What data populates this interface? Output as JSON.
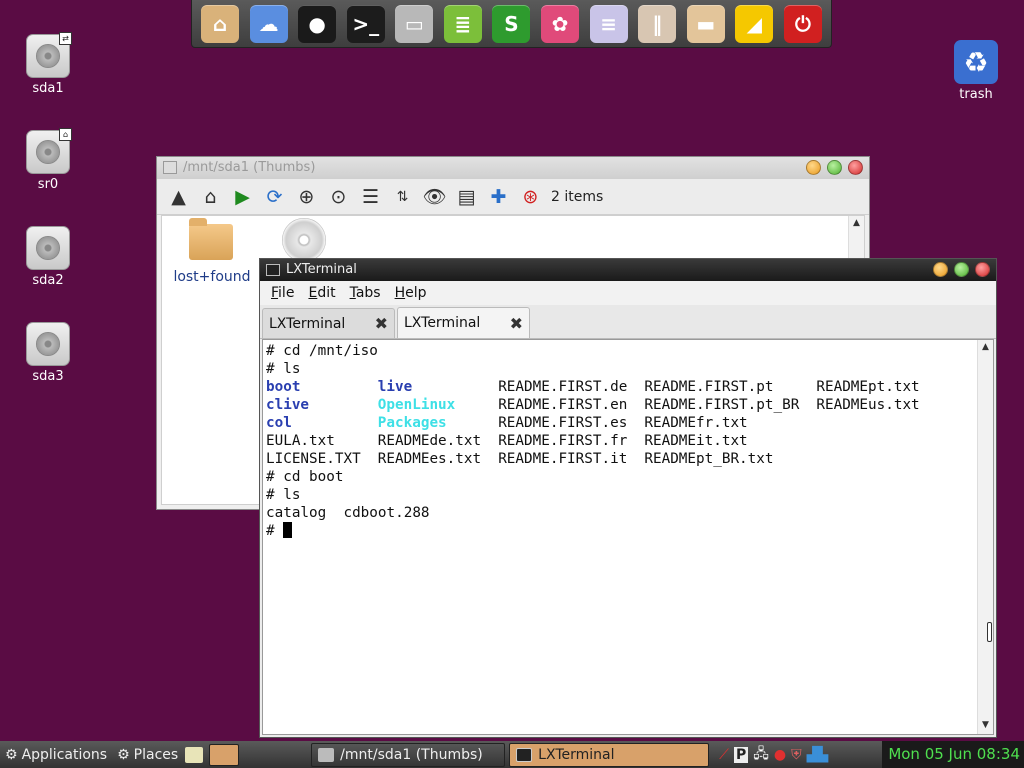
{
  "dock": {
    "items": [
      {
        "name": "home-folder-icon",
        "glyph": "⌂",
        "color": "#d9b27a"
      },
      {
        "name": "cloud-icon",
        "glyph": "☁",
        "color": "#5a8ee0"
      },
      {
        "name": "chat-icon",
        "glyph": "●",
        "color": "#1a1a1a"
      },
      {
        "name": "terminal-icon",
        "glyph": ">_",
        "color": "#1c1c1c"
      },
      {
        "name": "monitor-icon",
        "glyph": "▭",
        "color": "#b8b8b8"
      },
      {
        "name": "document-editor-icon",
        "glyph": "≣",
        "color": "#7cbf3a"
      },
      {
        "name": "spreadsheet-icon",
        "glyph": "S",
        "color": "#2e9b2e"
      },
      {
        "name": "color-palette-icon",
        "glyph": "✿",
        "color": "#e04a7a"
      },
      {
        "name": "text-file-icon",
        "glyph": "≡",
        "color": "#c9c4e8"
      },
      {
        "name": "settings-sliders-icon",
        "glyph": "‖",
        "color": "#d8c6b2"
      },
      {
        "name": "package-icon",
        "glyph": "▬",
        "color": "#e3c59a"
      },
      {
        "name": "volume-icon",
        "glyph": "◢",
        "color": "#f5c800"
      },
      {
        "name": "power-icon",
        "glyph": "⏻",
        "color": "#d12020"
      }
    ]
  },
  "desktop": {
    "icons": [
      {
        "label": "sda1"
      },
      {
        "label": "sr0"
      },
      {
        "label": "sda2"
      },
      {
        "label": "sda3"
      },
      {
        "label": "trash"
      }
    ]
  },
  "file_manager": {
    "title": "/mnt/sda1 (Thumbs)",
    "item_count": "2 items",
    "items": [
      {
        "label": "lost+found"
      }
    ]
  },
  "terminal": {
    "title": "LXTerminal",
    "menu": [
      "File",
      "Edit",
      "Tabs",
      "Help"
    ],
    "tabs": [
      {
        "label": "LXTerminal"
      },
      {
        "label": "LXTerminal"
      }
    ],
    "lines": [
      [
        {
          "t": "# cd /mnt/iso"
        }
      ],
      [
        {
          "t": "# ls"
        }
      ],
      [
        {
          "t": "boot",
          "c": "dir",
          "w": 13
        },
        {
          "t": "live",
          "c": "dir",
          "w": 14
        },
        {
          "t": "README.FIRST.de",
          "w": 17
        },
        {
          "t": "README.FIRST.pt",
          "w": 20
        },
        {
          "t": "READMEpt.txt"
        }
      ],
      [
        {
          "t": "clive",
          "c": "dir",
          "w": 13
        },
        {
          "t": "OpenLinux",
          "c": "link",
          "w": 14
        },
        {
          "t": "README.FIRST.en",
          "w": 17
        },
        {
          "t": "README.FIRST.pt_BR",
          "w": 20
        },
        {
          "t": "READMEus.txt"
        }
      ],
      [
        {
          "t": "col",
          "c": "dir",
          "w": 13
        },
        {
          "t": "Packages",
          "c": "link",
          "w": 14
        },
        {
          "t": "README.FIRST.es",
          "w": 17
        },
        {
          "t": "READMEfr.txt"
        }
      ],
      [
        {
          "t": "EULA.txt",
          "w": 13
        },
        {
          "t": "READMEde.txt",
          "w": 14
        },
        {
          "t": "README.FIRST.fr",
          "w": 17
        },
        {
          "t": "READMEit.txt"
        }
      ],
      [
        {
          "t": "LICENSE.TXT",
          "w": 13
        },
        {
          "t": "READMEes.txt",
          "w": 14
        },
        {
          "t": "README.FIRST.it",
          "w": 17
        },
        {
          "t": "READMEpt_BR.txt"
        }
      ],
      [
        {
          "t": "# cd boot"
        }
      ],
      [
        {
          "t": "# ls"
        }
      ],
      [
        {
          "t": "catalog  cdboot.288"
        }
      ],
      [
        {
          "t": "# ",
          "cursor": true
        }
      ]
    ]
  },
  "taskbar": {
    "applications_label": "Applications",
    "places_label": "Places",
    "tasks": [
      {
        "label": "/mnt/sda1 (Thumbs)"
      },
      {
        "label": "LXTerminal"
      }
    ],
    "clock": "Mon 05 Jun 08:34"
  }
}
